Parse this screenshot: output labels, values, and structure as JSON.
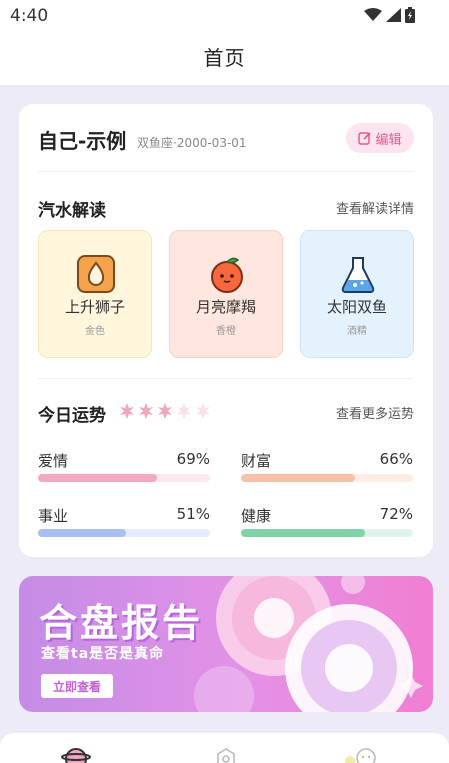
{
  "status_bar": {
    "time": "4:40",
    "icons": [
      "wifi-icon",
      "signal-icon",
      "battery-icon"
    ]
  },
  "nav": {
    "title": "首页"
  },
  "profile": {
    "name": "自己-示例",
    "meta": "双鱼座·2000-03-01",
    "edit_label": "编辑"
  },
  "soda": {
    "title": "汽水解读",
    "link": "查看解读详情",
    "tiles": [
      {
        "title": "上升狮子",
        "sub": "金色",
        "icon": "drop-icon",
        "bg": "#fff6dc",
        "border": "#f6e7b8"
      },
      {
        "title": "月亮摩羯",
        "sub": "香橙",
        "icon": "orange-icon",
        "bg": "#ffe6de",
        "border": "#f9d3c6"
      },
      {
        "title": "太阳双鱼",
        "sub": "酒精",
        "icon": "flask-icon",
        "bg": "#e4f2fd",
        "border": "#cde5f8"
      }
    ]
  },
  "fortune": {
    "title": "今日运势",
    "link": "查看更多运势",
    "stars_filled": 3,
    "stars_total": 5,
    "stats": [
      {
        "label": "爱情",
        "value": "69%",
        "percent": 69,
        "color": "#f4a9bf",
        "track": "#fde8ee"
      },
      {
        "label": "财富",
        "value": "66%",
        "percent": 66,
        "color": "#f7c2a8",
        "track": "#fdeee5"
      },
      {
        "label": "事业",
        "value": "51%",
        "percent": 51,
        "color": "#a9bff0",
        "track": "#e6ecfb"
      },
      {
        "label": "健康",
        "value": "72%",
        "percent": 72,
        "color": "#7fd3a7",
        "track": "#dff4e9"
      }
    ]
  },
  "banner": {
    "title": "合盘报告",
    "subtitle": "查看ta是否是真命",
    "button": "立即查看"
  },
  "colors": {
    "accent": "#e65b8d",
    "banner_purple": "#c48ce6"
  }
}
